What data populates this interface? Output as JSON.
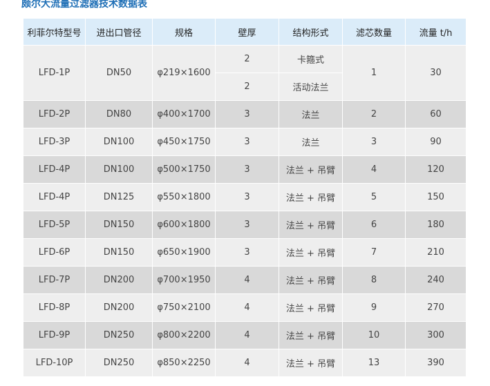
{
  "title": "颇尔大流量过滤器技术数据表",
  "headers": [
    "利菲尔特型号",
    "进出口管径",
    "规格",
    "壁厚",
    "结构形式",
    "滤芯数量",
    "流量 t/h"
  ],
  "first_row": {
    "model": "LFD-1P",
    "pipe": "DN50",
    "spec": "φ219×1600",
    "sub": [
      {
        "wall": "2",
        "structure": "卡箍式"
      },
      {
        "wall": "2",
        "structure": "活动法兰"
      }
    ],
    "cartridges": "1",
    "flow": "30"
  },
  "rows": [
    {
      "model": "LFD-2P",
      "pipe": "DN80",
      "spec": "φ400×1700",
      "wall": "3",
      "structure": "法兰",
      "cartridges": "2",
      "flow": "60"
    },
    {
      "model": "LFD-3P",
      "pipe": "DN100",
      "spec": "φ450×1750",
      "wall": "3",
      "structure": "法兰",
      "cartridges": "3",
      "flow": "90"
    },
    {
      "model": "LFD-4P",
      "pipe": "DN100",
      "spec": "φ500×1750",
      "wall": "3",
      "structure": "法兰 + 吊臂",
      "cartridges": "4",
      "flow": "120"
    },
    {
      "model": "LFD-4P",
      "pipe": "DN125",
      "spec": "φ550×1800",
      "wall": "3",
      "structure": "法兰 + 吊臂",
      "cartridges": "5",
      "flow": "150"
    },
    {
      "model": "LFD-5P",
      "pipe": "DN150",
      "spec": "φ600×1800",
      "wall": "3",
      "structure": "法兰 + 吊臂",
      "cartridges": "6",
      "flow": "180"
    },
    {
      "model": "LFD-6P",
      "pipe": "DN150",
      "spec": "φ650×1900",
      "wall": "3",
      "structure": "法兰 + 吊臂",
      "cartridges": "7",
      "flow": "210"
    },
    {
      "model": "LFD-7P",
      "pipe": "DN200",
      "spec": "φ700×1950",
      "wall": "4",
      "structure": "法兰 + 吊臂",
      "cartridges": "8",
      "flow": "240"
    },
    {
      "model": "LFD-8P",
      "pipe": "DN200",
      "spec": "φ750×2100",
      "wall": "4",
      "structure": "法兰 + 吊臂",
      "cartridges": "9",
      "flow": "270"
    },
    {
      "model": "LFD-9P",
      "pipe": "DN250",
      "spec": "φ800×2200",
      "wall": "4",
      "structure": "法兰 + 吊臂",
      "cartridges": "10",
      "flow": "300"
    },
    {
      "model": "LFD-10P",
      "pipe": "DN250",
      "spec": "φ850×2250",
      "wall": "4",
      "structure": "法兰 + 吊臂",
      "cartridges": "13",
      "flow": "390"
    }
  ]
}
